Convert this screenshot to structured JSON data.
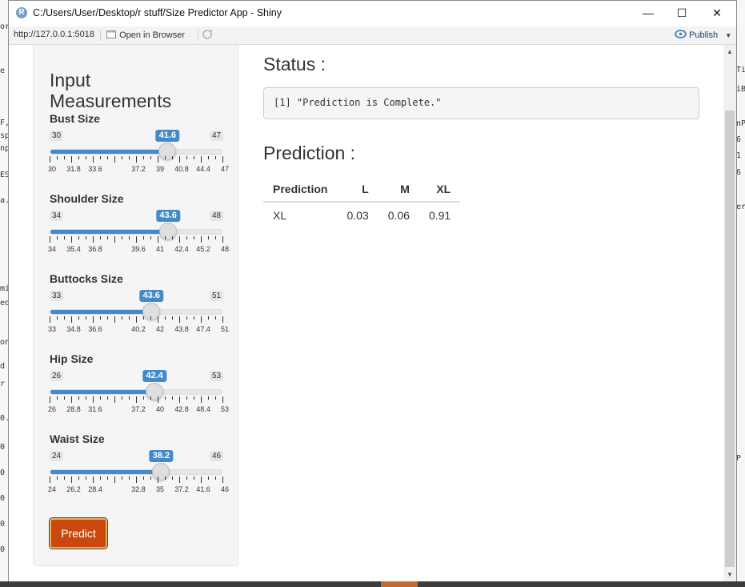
{
  "window": {
    "title": "C:/Users/User/Desktop/r stuff/Size Predictor App - Shiny",
    "app_icon": "R",
    "minimize": "—",
    "maximize": "☐",
    "close": "✕"
  },
  "toolbar": {
    "url": "http://127.0.0.1:5018",
    "open_browser": "Open in Browser",
    "publish": "Publish"
  },
  "left_strip": [
    "or",
    "e A",
    "F,",
    "sp",
    "np",
    "ES",
    "a.",
    "mi",
    "ed",
    "on",
    "d",
    "r s",
    "0.",
    "0",
    "0",
    "0",
    "0",
    "0"
  ],
  "right_strip": [
    "Ti",
    "iB",
    "nP",
    "6",
    "1",
    "6",
    "er",
    "P"
  ],
  "sidebar": {
    "title": "Input Measurements",
    "predict_label": "Predict",
    "sliders": [
      {
        "label": "Bust Size",
        "min": "30",
        "max": "47",
        "value": 41.6,
        "value_label": "41.6",
        "ticks": [
          "30",
          "31.8",
          "33.6",
          "37.2",
          "39",
          "40.8",
          "44.4",
          "47"
        ]
      },
      {
        "label": "Shoulder Size",
        "min": "34",
        "max": "48",
        "value": 43.6,
        "value_label": "43.6",
        "ticks": [
          "34",
          "35.4",
          "36.8",
          "39.6",
          "41",
          "42.4",
          "45.2",
          "48"
        ]
      },
      {
        "label": "Buttocks Size",
        "min": "33",
        "max": "51",
        "value": 43.6,
        "value_label": "43.6",
        "ticks": [
          "33",
          "34.8",
          "36.6",
          "40.2",
          "42",
          "43.8",
          "47.4",
          "51"
        ]
      },
      {
        "label": "Hip Size",
        "min": "26",
        "max": "53",
        "value": 42.4,
        "value_label": "42.4",
        "ticks": [
          "26",
          "28.8",
          "31.6",
          "37.2",
          "40",
          "42.8",
          "48.4",
          "53"
        ]
      },
      {
        "label": "Waist Size",
        "min": "24",
        "max": "46",
        "value": 38.2,
        "value_label": "38.2",
        "ticks": [
          "24",
          "26.2",
          "28.4",
          "32.8",
          "35",
          "37.2",
          "41.6",
          "46"
        ]
      }
    ]
  },
  "main": {
    "status_heading": "Status :",
    "status_text": "[1] \"Prediction is Complete.\"",
    "prediction_heading": "Prediction :",
    "table": {
      "headers": [
        "Prediction",
        "L",
        "M",
        "XL"
      ],
      "rows": [
        [
          "XL",
          "0.03",
          "0.06",
          "0.91"
        ]
      ]
    }
  },
  "colors": {
    "slider_accent": "#428bca",
    "predict_button": "#c9480f"
  }
}
